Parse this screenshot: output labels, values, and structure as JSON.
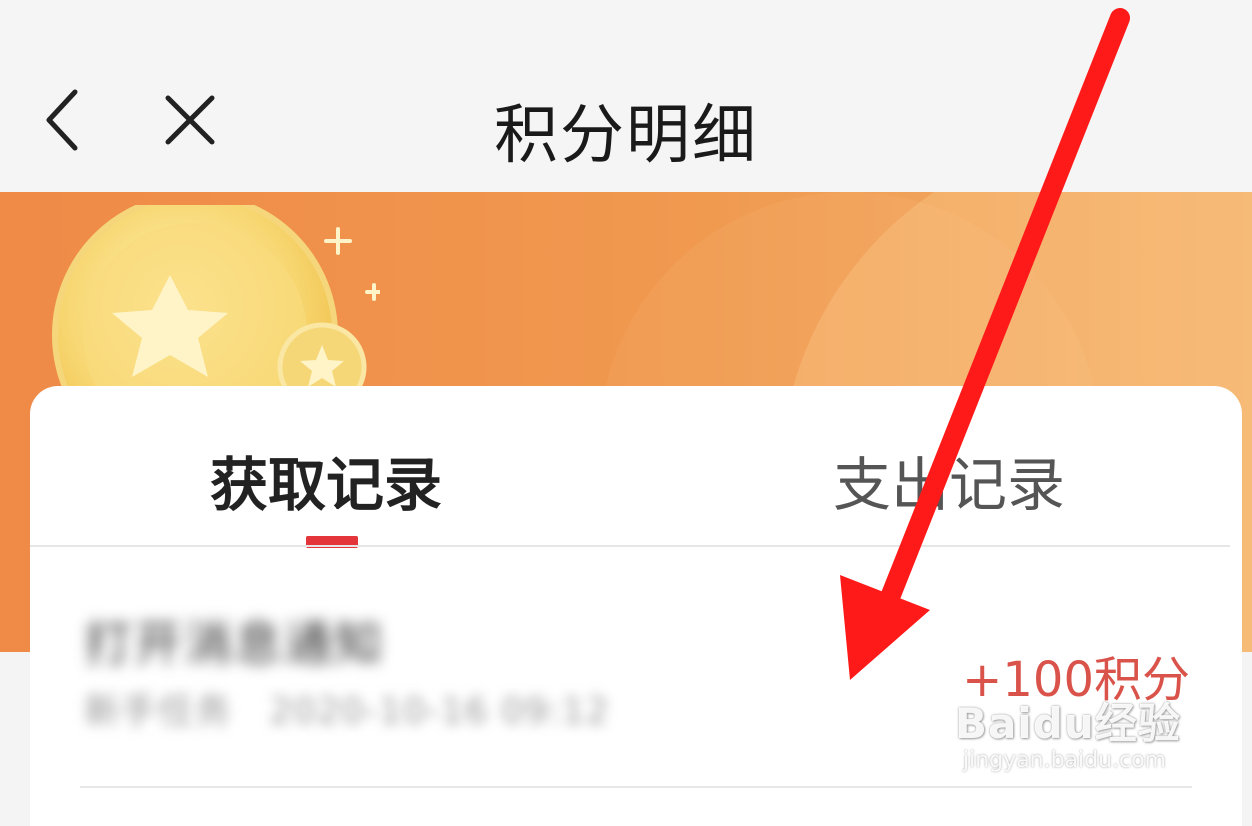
{
  "header": {
    "title": "积分明细",
    "back_icon": "chevron-left-icon",
    "close_icon": "close-icon"
  },
  "banner": {
    "illustration": "coin-star-icon",
    "colors": {
      "start": "#ef8a47",
      "end": "#f3b06a"
    }
  },
  "tabs": [
    {
      "label": "获取记录",
      "active": true
    },
    {
      "label": "支出记录",
      "active": false
    }
  ],
  "records": [
    {
      "title": "打开消息通知",
      "subtitle": "新手任务   2020-10-16 09:12",
      "points": "+100积分"
    }
  ],
  "watermark": {
    "logo": "Baidu经验",
    "url": "jingyan.baidu.com"
  },
  "colors": {
    "accent": "#e4353a",
    "points": "#d9534a",
    "annotation_arrow": "#ff1a1a"
  }
}
